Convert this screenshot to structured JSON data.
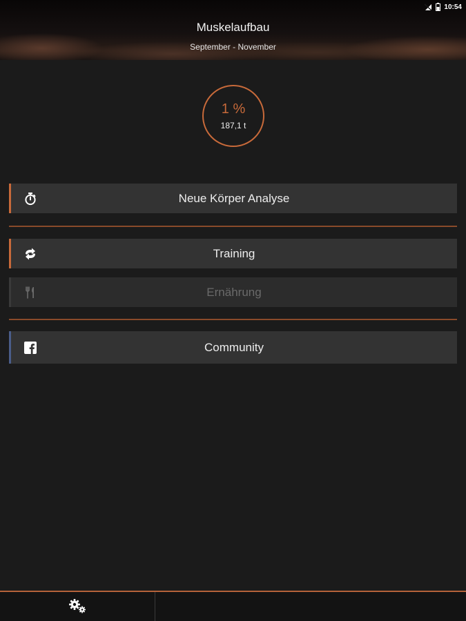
{
  "status_bar": {
    "time": "10:54",
    "icons": [
      "signal-off-icon",
      "battery-icon"
    ]
  },
  "header": {
    "title": "Muskelaufbau",
    "subtitle": "September - November"
  },
  "progress": {
    "percent_label": "1 %",
    "percent_value": 1,
    "weight_label": "187,1 t"
  },
  "menu": {
    "analyse_label": "Neue Körper Analyse",
    "training_label": "Training",
    "ernaehrung_label": "Ernährung",
    "community_label": "Community"
  },
  "icons": {
    "analyse": "stopwatch-icon",
    "training": "exchange-arrows-icon",
    "ernaehrung": "fork-knife-icon",
    "community": "facebook-icon",
    "settings": "gears-icon"
  },
  "colors": {
    "accent": "#c86a3a",
    "background": "#1b1b1b",
    "button": "#333333",
    "button_disabled": "#2c2c2c",
    "facebook_accent": "#4a5d8a"
  }
}
